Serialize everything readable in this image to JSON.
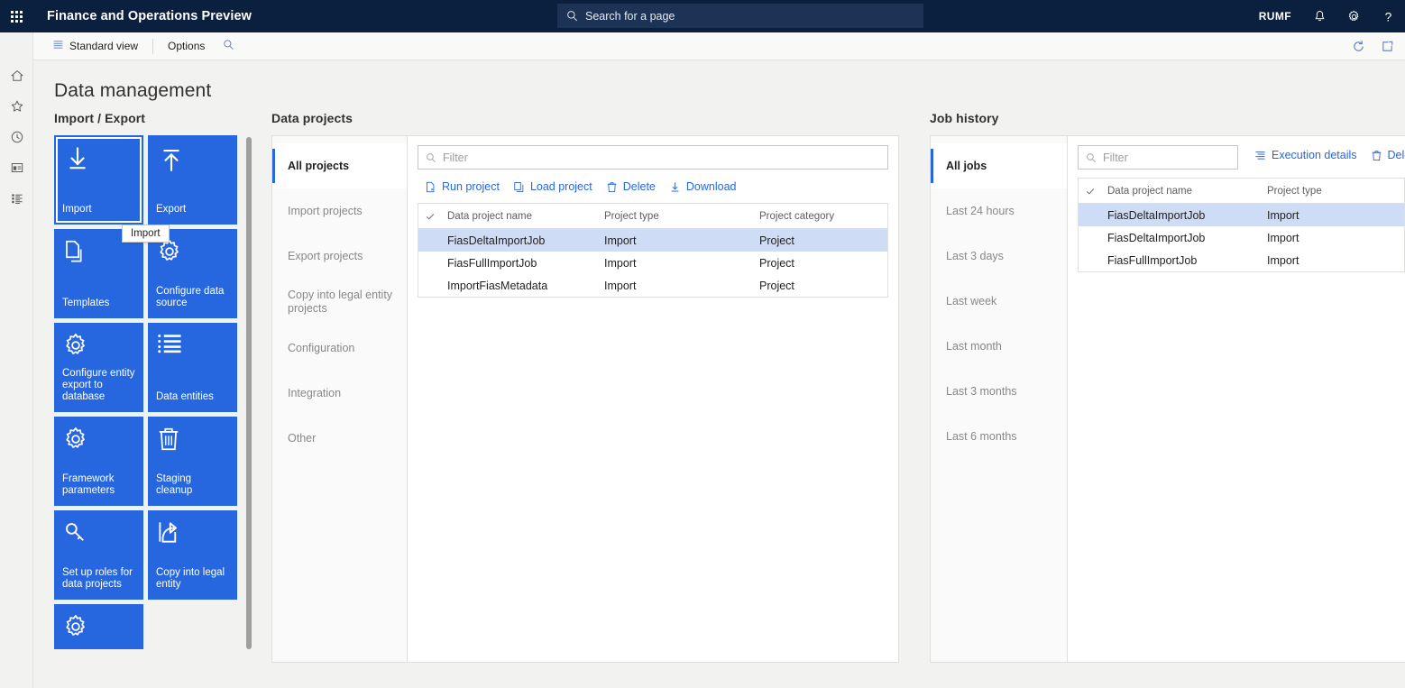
{
  "topbar": {
    "waffle_label": "app-launcher",
    "app_title": "Finance and Operations Preview",
    "search_placeholder": "Search for a page",
    "search_icon": "search-icon",
    "user_initials": "RUMF",
    "notifications_icon": "bell-icon",
    "settings_icon": "gear-icon",
    "help_icon": "question-mark-icon"
  },
  "actionbar": {
    "menu_icon": "hamburger-icon",
    "standard_view": "Standard view",
    "view_icon": "list-view-icon",
    "options": "Options",
    "search_icon": "search-icon",
    "refresh_icon": "refresh-icon",
    "open_in_new_icon": "open-in-new-window-icon"
  },
  "leftrail": {
    "items": [
      {
        "name": "home-icon",
        "label": "Home"
      },
      {
        "name": "star-icon",
        "label": "Favorites"
      },
      {
        "name": "clock-icon",
        "label": "Recent"
      },
      {
        "name": "workspace-icon",
        "label": "Workspaces"
      },
      {
        "name": "modules-icon",
        "label": "Modules"
      }
    ]
  },
  "page": {
    "title": "Data management"
  },
  "import_export": {
    "heading": "Import / Export",
    "tooltip": "Import",
    "tiles": [
      {
        "label": "Import",
        "icon": "download-arrow-icon",
        "selected": true
      },
      {
        "label": "Export",
        "icon": "upload-arrow-icon",
        "selected": false
      },
      {
        "label": "Templates",
        "icon": "copy-pages-icon",
        "selected": false
      },
      {
        "label": "Configure data source",
        "icon": "gear-icon",
        "selected": false
      },
      {
        "label": "Configure entity export to database",
        "icon": "gear-icon",
        "selected": false
      },
      {
        "label": "Data entities",
        "icon": "bulleted-list-icon",
        "selected": false
      },
      {
        "label": "Framework parameters",
        "icon": "gear-icon",
        "selected": false
      },
      {
        "label": "Staging cleanup",
        "icon": "trash-icon",
        "selected": false
      },
      {
        "label": "Set up roles for data projects",
        "icon": "key-icon",
        "selected": false
      },
      {
        "label": "Copy into legal entity",
        "icon": "share-arrow-icon",
        "selected": false
      },
      {
        "label": "",
        "icon": "gear-icon",
        "selected": false
      }
    ]
  },
  "data_projects": {
    "heading": "Data projects",
    "nav": [
      {
        "label": "All projects",
        "active": true
      },
      {
        "label": "Import projects",
        "active": false
      },
      {
        "label": "Export projects",
        "active": false
      },
      {
        "label": "Copy into legal entity projects",
        "active": false
      },
      {
        "label": "Configuration",
        "active": false
      },
      {
        "label": "Integration",
        "active": false
      },
      {
        "label": "Other",
        "active": false
      }
    ],
    "filter_placeholder": "Filter",
    "commands": [
      {
        "label": "Run project",
        "icon": "run-page-icon"
      },
      {
        "label": "Load project",
        "icon": "copy-icon"
      },
      {
        "label": "Delete",
        "icon": "trash-icon"
      },
      {
        "label": "Download",
        "icon": "download-icon"
      }
    ],
    "columns": [
      "Data project name",
      "Project type",
      "Project category"
    ],
    "rows": [
      {
        "name": "FiasDeltaImportJob",
        "type": "Import",
        "category": "Project",
        "selected": true
      },
      {
        "name": "FiasFullImportJob",
        "type": "Import",
        "category": "Project",
        "selected": false
      },
      {
        "name": "ImportFiasMetadata",
        "type": "Import",
        "category": "Project",
        "selected": false
      }
    ]
  },
  "job_history": {
    "heading": "Job history",
    "nav": [
      {
        "label": "All jobs",
        "active": true
      },
      {
        "label": "Last 24 hours",
        "active": false
      },
      {
        "label": "Last 3 days",
        "active": false
      },
      {
        "label": "Last week",
        "active": false
      },
      {
        "label": "Last month",
        "active": false
      },
      {
        "label": "Last 3 months",
        "active": false
      },
      {
        "label": "Last 6 months",
        "active": false
      }
    ],
    "filter_placeholder": "Filter",
    "commands": [
      {
        "label": "Execution details",
        "icon": "details-list-icon"
      },
      {
        "label": "Delete",
        "icon": "trash-icon"
      }
    ],
    "columns": [
      "Data project name",
      "Project type"
    ],
    "rows": [
      {
        "name": "FiasDeltaImportJob",
        "type": "Import",
        "selected": true
      },
      {
        "name": "FiasDeltaImportJob",
        "type": "Import",
        "selected": false
      },
      {
        "name": "FiasFullImportJob",
        "type": "Import",
        "selected": false
      }
    ]
  },
  "colors": {
    "topbar_bg": "#0b1f3f",
    "tile_blue": "#2667e0",
    "accent": "#2667e0",
    "row_selected": "#cfdcf5",
    "page_bg": "#f2f2f1"
  }
}
